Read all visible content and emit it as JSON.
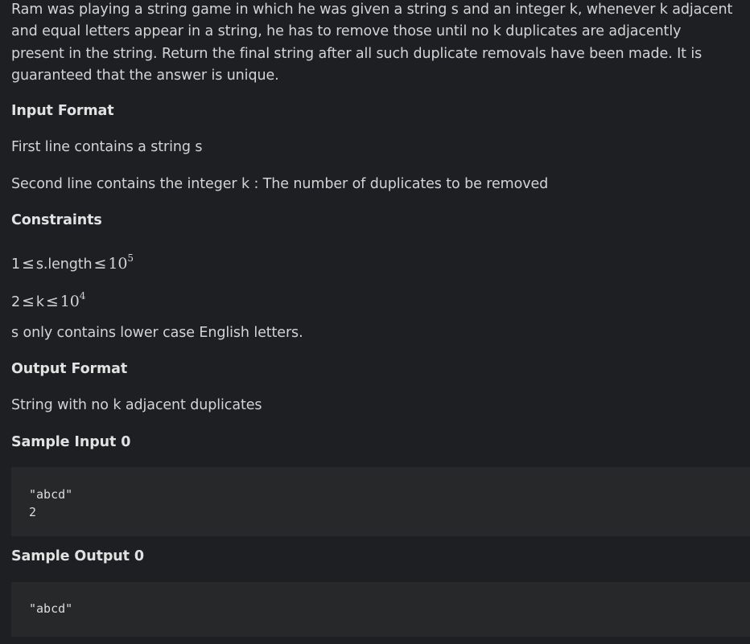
{
  "problem": {
    "description": "Ram was playing a string game in which he was given a string s and an integer k, whenever k adjacent and equal letters appear in a string, he has to remove those until no k duplicates are adjacently present in the string. Return the final string after all such duplicate removals have been made. It is guaranteed that the answer is unique.",
    "input_format": {
      "heading": "Input Format",
      "line1": "First line contains a string s",
      "line2": "Second line contains the integer k : The number of duplicates to be removed"
    },
    "constraints": {
      "heading": "Constraints",
      "c1_lhs": "1",
      "c1_var": "s.length",
      "c1_base": "10",
      "c1_exp": "5",
      "c2_lhs": "2",
      "c2_var": "k",
      "c2_base": "10",
      "c2_exp": "4",
      "leq_symbol": "≤",
      "note": "s only contains lower case English letters."
    },
    "output_format": {
      "heading": "Output Format",
      "text": "String with no k adjacent duplicates"
    },
    "sample_input": {
      "heading": "Sample Input 0",
      "line1": "\"abcd\"",
      "line2": "2"
    },
    "sample_output": {
      "heading": "Sample Output 0",
      "line1": "\"abcd\""
    }
  },
  "colors": {
    "background": "#1e1f22",
    "code_background": "#272829",
    "text": "#d4d4d4"
  }
}
